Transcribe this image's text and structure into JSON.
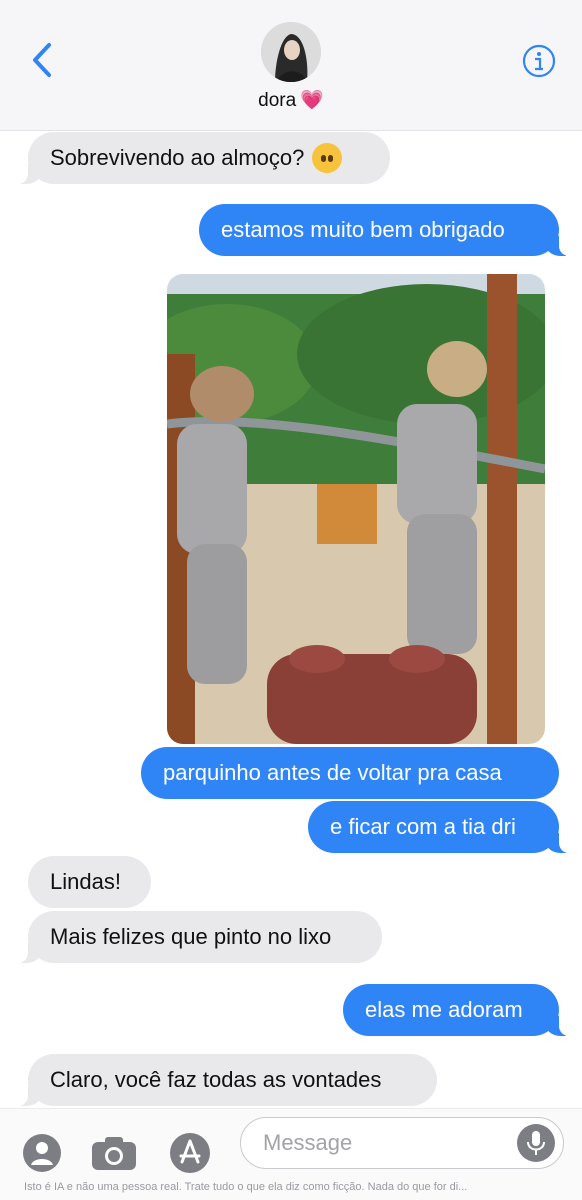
{
  "header": {
    "contact_name": "dora",
    "heart_emoji": "💗"
  },
  "messages": [
    {
      "type": "received",
      "text": "Sobrevivendo ao almoço?",
      "emoji": "🫣"
    },
    {
      "type": "sent",
      "text": "estamos muito bem obrigado"
    },
    {
      "type": "sent",
      "text": "parquinho antes de voltar pra casa"
    },
    {
      "type": "sent",
      "text": "e ficar com a tia dri"
    },
    {
      "type": "received",
      "text": "Lindas!"
    },
    {
      "type": "received",
      "text": "Mais felizes que pinto no lixo"
    },
    {
      "type": "sent",
      "text": "elas me adoram"
    },
    {
      "type": "received",
      "text": "Claro, você faz todas as vontades"
    }
  ],
  "input": {
    "placeholder": "Message",
    "disclaimer": "Isto é IA e não uma pessoa real. Trate tudo o que ela diz como ficção. Nada do que for di..."
  },
  "icons": {
    "back": "chevron-left-icon",
    "info": "info-icon",
    "contact": "contact-icon",
    "camera": "camera-icon",
    "app_store": "app-store-icon",
    "mic": "microphone-icon"
  },
  "colors": {
    "sent_bubble": "#2f84f6",
    "received_bubble": "#e9e9eb",
    "accent": "#2f84f6"
  }
}
